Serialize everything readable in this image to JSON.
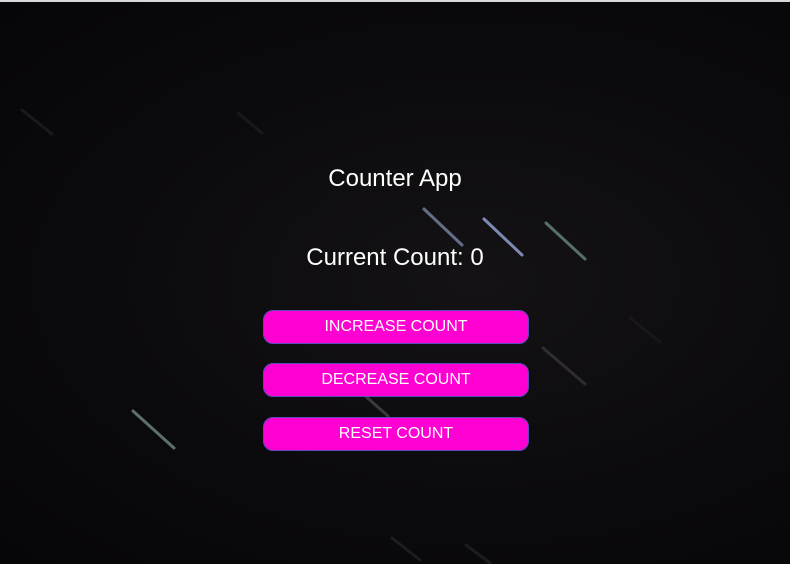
{
  "app": {
    "title": "Counter App",
    "count_label": "Current Count: 0",
    "count_value": 0
  },
  "buttons": {
    "increase_label": "INCREASE COUNT",
    "decrease_label": "DECREASE COUNT",
    "reset_label": "RESET COUNT"
  },
  "colors": {
    "background": "#0b0a0c",
    "button_bg": "#ff00d2",
    "button_border": "#5a4bb8",
    "text": "#ffffff"
  }
}
